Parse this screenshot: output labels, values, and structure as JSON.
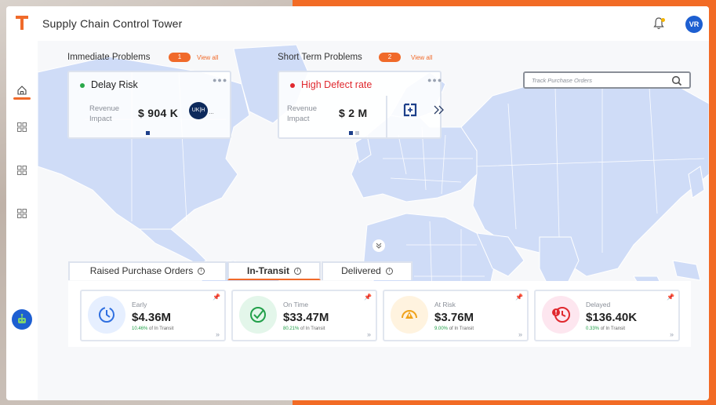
{
  "app": {
    "title": "Supply Chain Control Tower",
    "user_initials": "VR"
  },
  "sections": {
    "immediate": {
      "title": "Immediate Problems",
      "count": "1",
      "view_all": "View all"
    },
    "short_term": {
      "title": "Short Term Problems",
      "count": "2",
      "view_all": "View all"
    }
  },
  "cards": [
    {
      "title": "Delay Risk",
      "status_color": "#2aa84a",
      "revenue_label_1": "Revenue",
      "revenue_label_2": "Impact",
      "amount": "$ 904 K",
      "logo_text": "UK|H"
    },
    {
      "title": "High Defect rate",
      "status_color": "#e0282e",
      "revenue_label_1": "Revenue",
      "revenue_label_2": "Impact",
      "amount": "$ 2 M"
    }
  ],
  "search": {
    "placeholder": "Track Purchase Orders"
  },
  "tabs": [
    {
      "label": "Raised Purchase Orders",
      "active": false
    },
    {
      "label": "In-Transit",
      "active": true
    },
    {
      "label": "Delivered",
      "active": false
    }
  ],
  "kpis": [
    {
      "label": "Early",
      "value": "$4.36M",
      "pct": "10.46%",
      "suffix": "of In Transit",
      "tint": "#e6efff",
      "color": "#2f6fe0",
      "icon": "clock-icon"
    },
    {
      "label": "On Time",
      "value": "$33.47M",
      "pct": "80.21%",
      "suffix": "of In Transit",
      "tint": "#e3f6ea",
      "color": "#22a04a",
      "icon": "check-clock-icon"
    },
    {
      "label": "At Risk",
      "value": "$3.76M",
      "pct": "9.00%",
      "suffix": "of In Transit",
      "tint": "#fff3df",
      "color": "#f0a21a",
      "icon": "warning-gauge-icon"
    },
    {
      "label": "Delayed",
      "value": "$136.40K",
      "pct": "0.33%",
      "suffix": "of In Transit",
      "tint": "#fde6ef",
      "color": "#e0282e",
      "icon": "alert-clock-icon"
    }
  ],
  "colors": {
    "accent": "#f06a2a",
    "primary": "#1d5fd1",
    "map_land": "#cfdcf7"
  }
}
